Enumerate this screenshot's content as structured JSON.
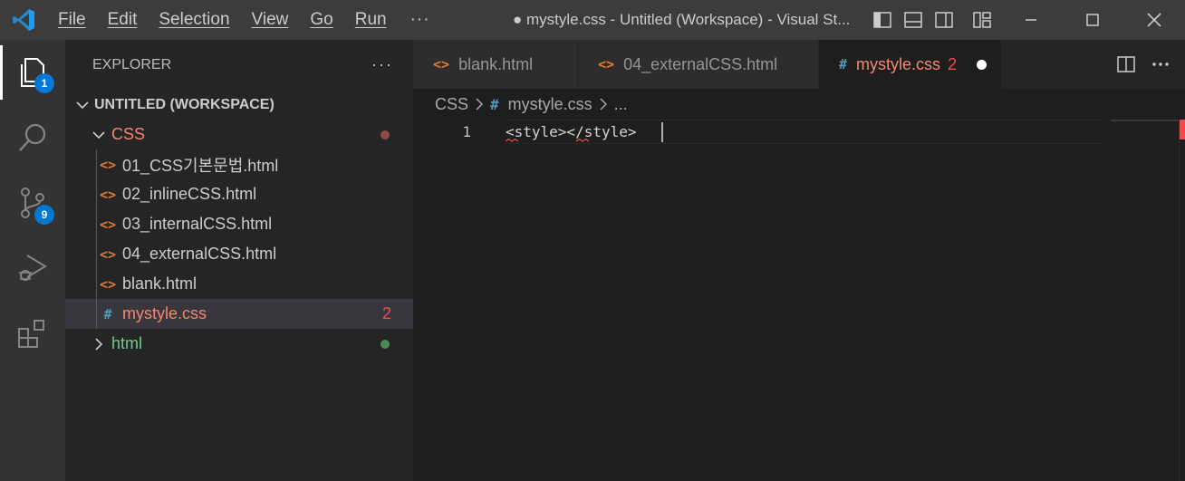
{
  "titlebar": {
    "menu": [
      "File",
      "Edit",
      "Selection",
      "View",
      "Go",
      "Run"
    ],
    "more": "···",
    "title": "● mystyle.css - Untitled (Workspace) - Visual St..."
  },
  "activity": {
    "explorer_badge": "1",
    "scm_badge": "9"
  },
  "sidebar": {
    "header": "EXPLORER",
    "more": "···",
    "workspace": "UNTITLED (WORKSPACE)",
    "folder_css": "CSS",
    "files": [
      {
        "name": "01_CSS기본문법.html",
        "icon": "<>"
      },
      {
        "name": "02_inlineCSS.html",
        "icon": "<>"
      },
      {
        "name": "03_internalCSS.html",
        "icon": "<>"
      },
      {
        "name": "04_externalCSS.html",
        "icon": "<>"
      },
      {
        "name": "blank.html",
        "icon": "<>"
      },
      {
        "name": "mystyle.css",
        "icon": "#",
        "problems": "2"
      }
    ],
    "folder_html": "html",
    "colors": {
      "error": "#f14c4c",
      "modified_dot": "#8c4a4a",
      "untracked_dot": "#4e8a53",
      "folder_html_color": "#73c991",
      "folder_css_color": "#f48771"
    }
  },
  "tabs": [
    {
      "label": "blank.html",
      "icon": "<>"
    },
    {
      "label": "04_externalCSS.html",
      "icon": "<>"
    },
    {
      "label": "mystyle.css",
      "icon": "#",
      "problems": "2",
      "active": true
    }
  ],
  "breadcrumb": {
    "folder": "CSS",
    "file": "mystyle.css",
    "more": "..."
  },
  "editor": {
    "line_number": "1",
    "code": "<style></style>",
    "code_parts": [
      "<",
      "style",
      "></",
      "style",
      ">"
    ]
  }
}
